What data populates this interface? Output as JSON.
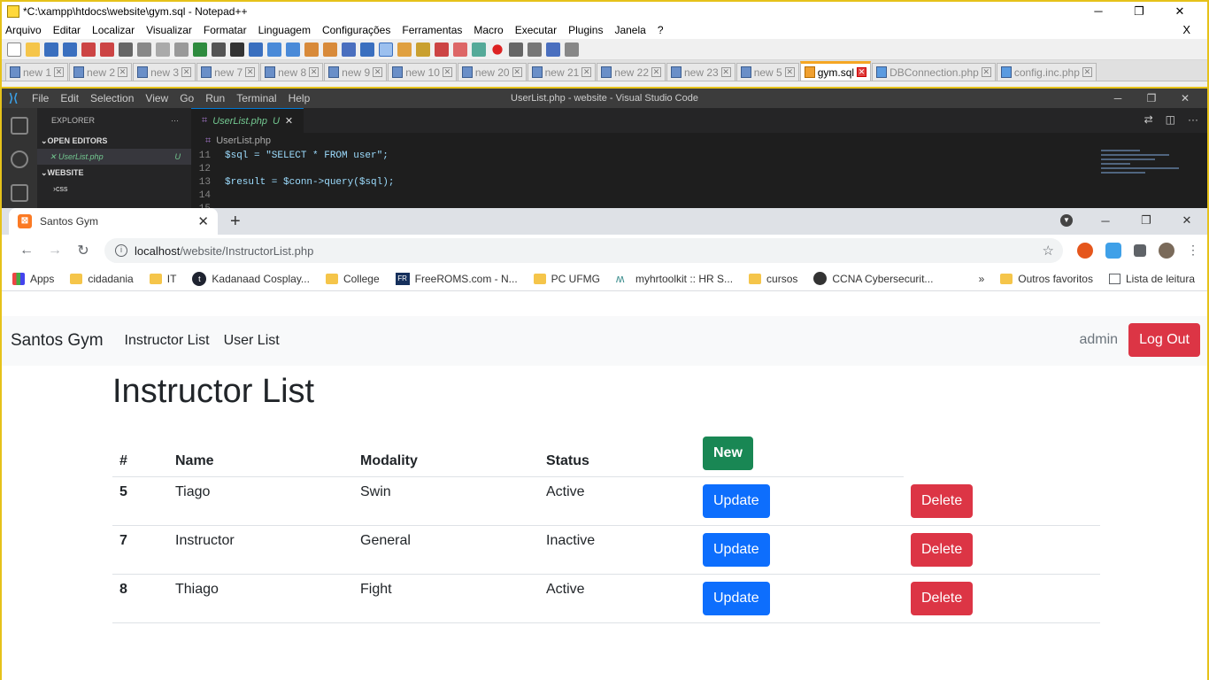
{
  "notepad": {
    "title": "*C:\\xampp\\htdocs\\website\\gym.sql - Notepad++",
    "window_controls": [
      "─",
      "❐",
      "✕"
    ],
    "menu": [
      "Arquivo",
      "Editar",
      "Localizar",
      "Visualizar",
      "Formatar",
      "Linguagem",
      "Configurações",
      "Ferramentas",
      "Macro",
      "Executar",
      "Plugins",
      "Janela",
      "?"
    ],
    "menu_close": "X",
    "tabs": [
      "new 1",
      "new 2",
      "new 3",
      "new 7",
      "new 8",
      "new 9",
      "new 10",
      "new 20",
      "new 21",
      "new 22",
      "new 23",
      "new 5",
      "gym.sql",
      "DBConnection.php",
      "config.inc.php"
    ],
    "active_tab": "gym.sql"
  },
  "vscode": {
    "menu": [
      "File",
      "Edit",
      "Selection",
      "View",
      "Go",
      "Run",
      "Terminal",
      "Help"
    ],
    "title": "UserList.php - website - Visual Studio Code",
    "explorer_label": "EXPLORER",
    "open_editors_label": "OPEN EDITORS",
    "open_file": "UserList.php",
    "open_file_status": "U",
    "website_label": "WEBSITE",
    "folder_css": "css",
    "tab_label": "UserList.php",
    "tab_status": "U",
    "breadcrumb": "UserList.php",
    "code": [
      {
        "ln": "11",
        "text": "$sql = \"SELECT * FROM user\";"
      },
      {
        "ln": "12",
        "text": ""
      },
      {
        "ln": "13",
        "text": "$result = $conn->query($sql);"
      },
      {
        "ln": "14",
        "text": ""
      },
      {
        "ln": "15",
        "text": ""
      }
    ]
  },
  "chrome": {
    "tab_title": "Santos Gym",
    "url_host": "localhost",
    "url_path": "/website/InstructorList.php",
    "bookmarks": [
      {
        "label": "Apps",
        "icon": "apps-grid-icon"
      },
      {
        "label": "cidadania",
        "icon": "folder-icon"
      },
      {
        "label": "IT",
        "icon": "folder-icon"
      },
      {
        "label": "Kadanaad Cosplay...",
        "icon": "kadanaad-icon"
      },
      {
        "label": "College",
        "icon": "folder-icon"
      },
      {
        "label": "FreeROMS.com - N...",
        "icon": "freeroms-icon"
      },
      {
        "label": "PC UFMG",
        "icon": "folder-icon"
      },
      {
        "label": "myhrtoolkit :: HR S...",
        "icon": "myhrtoolkit-icon"
      },
      {
        "label": "cursos",
        "icon": "folder-icon"
      },
      {
        "label": "CCNA Cybersecurit...",
        "icon": "cisco-icon"
      }
    ],
    "bookmarks_more": "»",
    "other_favorites": "Outros favoritos",
    "reading_list": "Lista de leitura"
  },
  "site": {
    "brand": "Santos Gym",
    "nav_links": [
      "Instructor List",
      "User List"
    ],
    "user": "admin",
    "logout": "Log Out",
    "heading": "Instructor List",
    "columns": [
      "#",
      "Name",
      "Modality",
      "Status"
    ],
    "new_button": "New",
    "update_label": "Update",
    "delete_label": "Delete",
    "rows": [
      {
        "id": "5",
        "name": "Tiago",
        "modality": "Swin",
        "status": "Active"
      },
      {
        "id": "7",
        "name": "Instructor",
        "modality": "General",
        "status": "Inactive"
      },
      {
        "id": "8",
        "name": "Thiago",
        "modality": "Fight",
        "status": "Active"
      }
    ]
  },
  "colors": {
    "danger": "#dc3545",
    "success": "#198754",
    "primary": "#0d6efd",
    "window_border": "#e6c21a"
  }
}
